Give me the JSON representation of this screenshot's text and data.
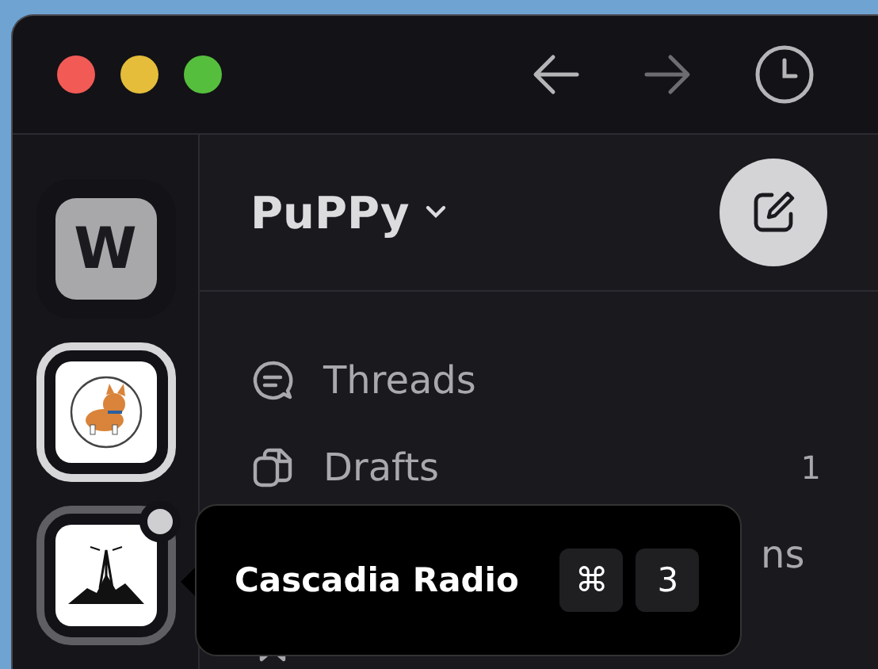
{
  "workspaces": [
    {
      "kind": "letter",
      "letter": "W",
      "selected": false,
      "hovered": false,
      "unread": false
    },
    {
      "kind": "logo",
      "selected": true,
      "hovered": false,
      "unread": false
    },
    {
      "kind": "mountain",
      "selected": false,
      "hovered": true,
      "unread": true
    }
  ],
  "workspace_name": "PuPPy",
  "nav": [
    {
      "kind": "threads",
      "label": "Threads"
    },
    {
      "kind": "drafts",
      "label": "Drafts",
      "count": "1"
    },
    {
      "kind": "hidden",
      "label": "ns"
    },
    {
      "kind": "saved"
    }
  ],
  "tooltip": {
    "title": "Cascadia Radio",
    "keys": [
      "⌘",
      "3"
    ]
  }
}
